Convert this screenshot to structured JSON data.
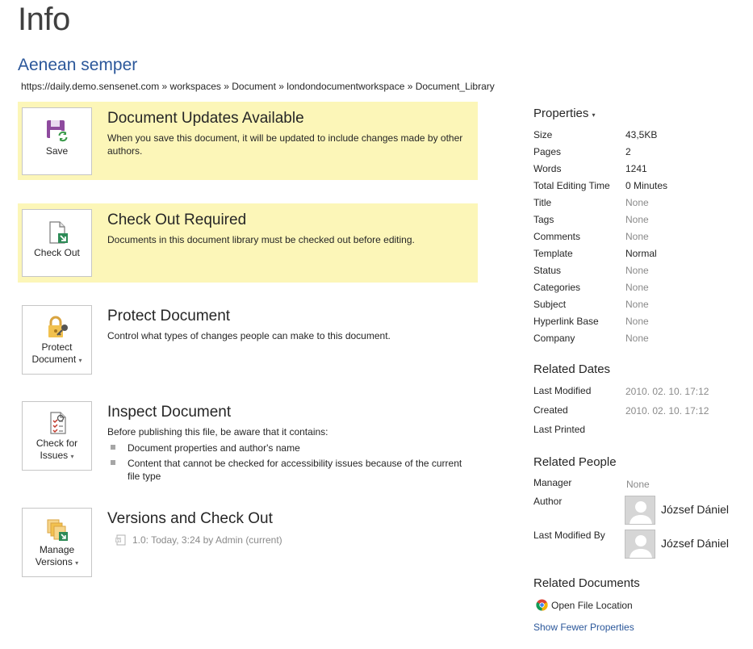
{
  "header": {
    "title": "Info",
    "document_title": "Aenean semper",
    "breadcrumb": "https://daily.demo.sensenet.com » workspaces » Document » londondocumentworkspace » Document_Library"
  },
  "sections": {
    "updates": {
      "button_label": "Save",
      "heading": "Document Updates Available",
      "description": "When you save this document, it will be updated to include changes made by other authors."
    },
    "checkout": {
      "button_label": "Check Out",
      "heading": "Check Out Required",
      "description": "Documents in this document library must be checked out before editing."
    },
    "protect": {
      "button_line1": "Protect",
      "button_line2": "Document",
      "heading": "Protect Document",
      "description": "Control what types of changes people can make to this document."
    },
    "inspect": {
      "button_line1": "Check for",
      "button_line2": "Issues",
      "heading": "Inspect Document",
      "description": "Before publishing this file, be aware that it contains:",
      "bullets": [
        "Document properties and author's name",
        "Content that cannot be checked for accessibility issues because of the current file type"
      ]
    },
    "versions": {
      "button_line1": "Manage",
      "button_line2": "Versions",
      "heading": "Versions and Check Out",
      "version_entry": "1.0: Today, 3:24 by Admin (current)"
    }
  },
  "properties": {
    "heading": "Properties",
    "rows": [
      {
        "key": "Size",
        "value": "43,5KB"
      },
      {
        "key": "Pages",
        "value": "2"
      },
      {
        "key": "Words",
        "value": "1241"
      },
      {
        "key": "Total Editing Time",
        "value": "0 Minutes"
      },
      {
        "key": "Title",
        "value": "None"
      },
      {
        "key": "Tags",
        "value": "None"
      },
      {
        "key": "Comments",
        "value": "None"
      },
      {
        "key": "Template",
        "value": "Normal"
      },
      {
        "key": "Status",
        "value": "None"
      },
      {
        "key": "Categories",
        "value": "None"
      },
      {
        "key": "Subject",
        "value": "None"
      },
      {
        "key": "Hyperlink Base",
        "value": "None"
      },
      {
        "key": "Company",
        "value": "None"
      }
    ]
  },
  "related_dates": {
    "heading": "Related Dates",
    "rows": [
      {
        "key": "Last Modified",
        "value": "2010. 02. 10. 17:12"
      },
      {
        "key": "Created",
        "value": "2010. 02. 10. 17:12"
      },
      {
        "key": "Last Printed",
        "value": ""
      }
    ]
  },
  "related_people": {
    "heading": "Related People",
    "manager_label": "Manager",
    "manager_value": "None",
    "author_label": "Author",
    "author_name": "József Dániel",
    "last_modified_by_label": "Last Modified By",
    "last_modified_by_name": "József Dániel"
  },
  "related_documents": {
    "heading": "Related Documents",
    "open_file_location": "Open File Location",
    "show_fewer": "Show Fewer Properties"
  }
}
